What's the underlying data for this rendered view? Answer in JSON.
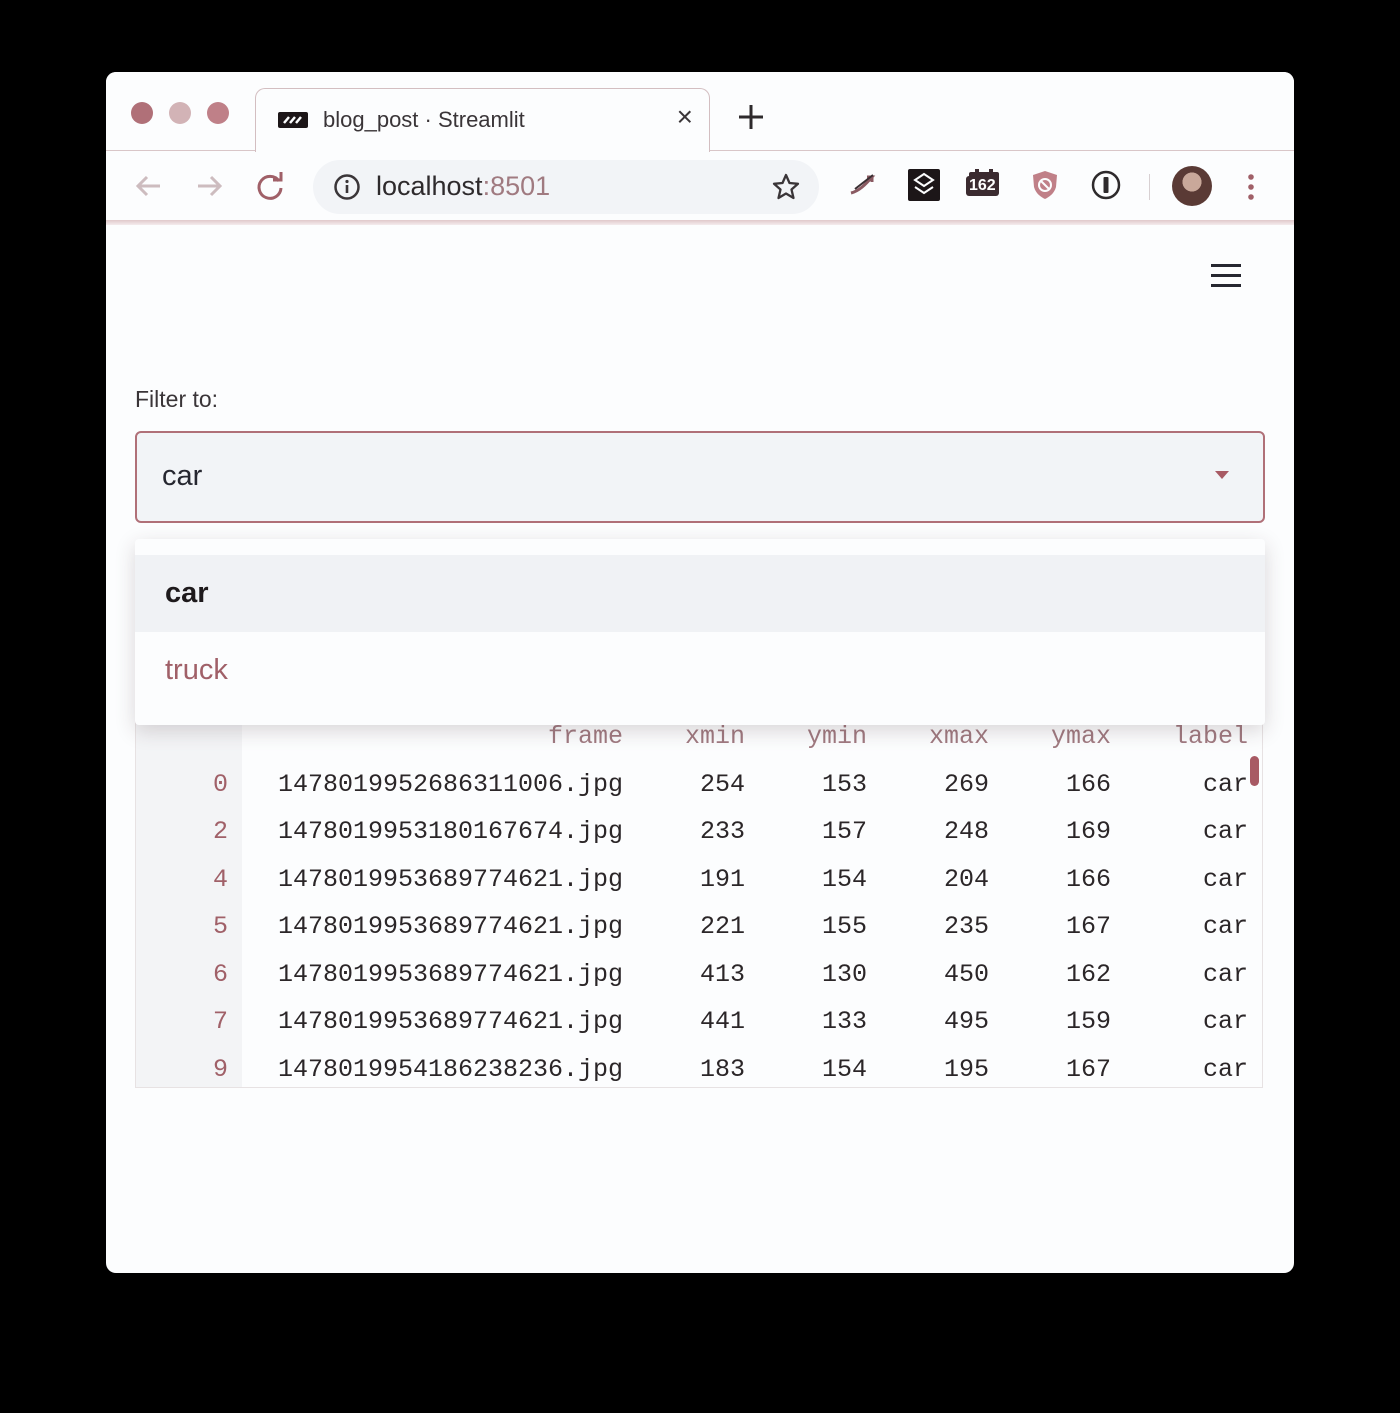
{
  "browser": {
    "tab_title": "blog_post · Streamlit",
    "tab_close": "×",
    "url_host": "localhost",
    "url_port": ":8501",
    "extension_badge": "162"
  },
  "app": {
    "filter_label": "Filter to:",
    "select_value": "car",
    "dropdown_options": [
      "car",
      "truck"
    ],
    "selected_option": "car"
  },
  "dataframe": {
    "columns": [
      "frame",
      "xmin",
      "ymin",
      "xmax",
      "ymax",
      "label"
    ],
    "rows": [
      {
        "index": "0",
        "frame": "1478019952686311006.jpg",
        "xmin": "254",
        "ymin": "153",
        "xmax": "269",
        "ymax": "166",
        "label": "car"
      },
      {
        "index": "2",
        "frame": "1478019953180167674.jpg",
        "xmin": "233",
        "ymin": "157",
        "xmax": "248",
        "ymax": "169",
        "label": "car"
      },
      {
        "index": "4",
        "frame": "1478019953689774621.jpg",
        "xmin": "191",
        "ymin": "154",
        "xmax": "204",
        "ymax": "166",
        "label": "car"
      },
      {
        "index": "5",
        "frame": "1478019953689774621.jpg",
        "xmin": "221",
        "ymin": "155",
        "xmax": "235",
        "ymax": "167",
        "label": "car"
      },
      {
        "index": "6",
        "frame": "1478019953689774621.jpg",
        "xmin": "413",
        "ymin": "130",
        "xmax": "450",
        "ymax": "162",
        "label": "car"
      },
      {
        "index": "7",
        "frame": "1478019953689774621.jpg",
        "xmin": "441",
        "ymin": "133",
        "xmax": "495",
        "ymax": "159",
        "label": "car"
      },
      {
        "index": "9",
        "frame": "1478019954186238236.jpg",
        "xmin": "183",
        "ymin": "154",
        "xmax": "195",
        "ymax": "167",
        "label": "car"
      }
    ]
  },
  "colors": {
    "accent": "#b07078",
    "index_text": "#a06068",
    "background": "#fcfdfe"
  },
  "icons": [
    "back-arrow-icon",
    "forward-arrow-icon",
    "reload-icon",
    "info-icon",
    "star-icon",
    "hamburger-menu-icon",
    "chevron-down-icon"
  ]
}
